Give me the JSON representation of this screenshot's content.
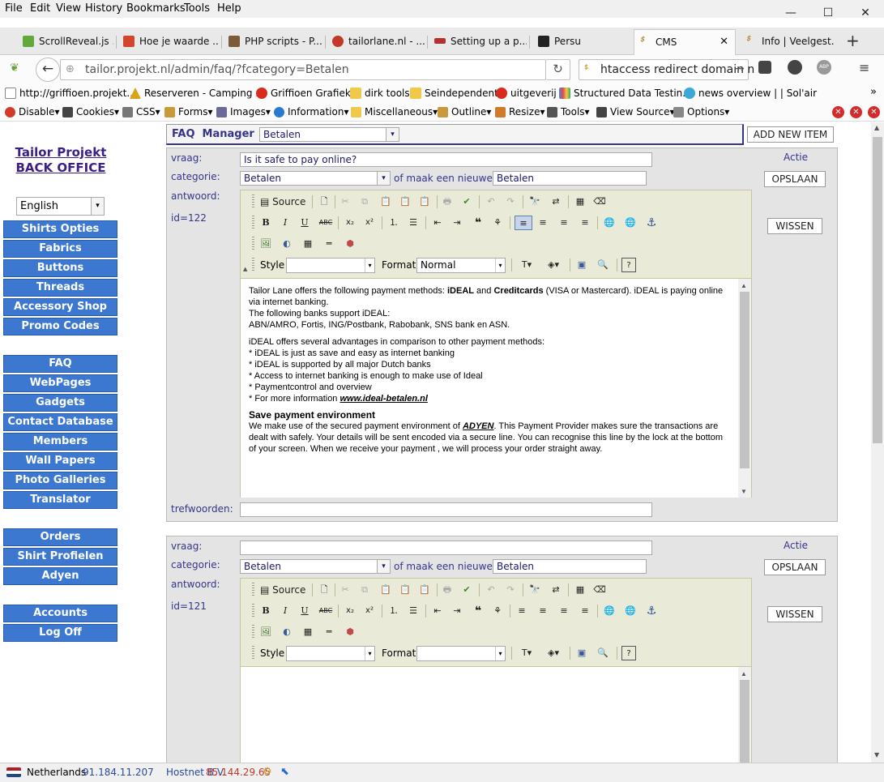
{
  "menubar": {
    "items": [
      "File",
      "Edit",
      "View",
      "History",
      "Bookmarks",
      "Tools",
      "Help"
    ]
  },
  "tabs": [
    {
      "label": "ScrollReveal.js ...",
      "color": "#62a83c"
    },
    {
      "label": "Hoe je waarde ...",
      "color": "#d2452f"
    },
    {
      "label": "PHP scripts - P...",
      "color": "#7b5b3a"
    },
    {
      "label": "tailorlane.nl - ...",
      "color": "#c0392b"
    },
    {
      "label": "Setting up a p...",
      "color": "#b73030"
    },
    {
      "label": "Persu",
      "color": "#222222"
    },
    {
      "label": "CMS",
      "color": "#b5862a"
    },
    {
      "label": "Info | Veelgest...",
      "color": "#b5862a"
    }
  ],
  "nav": {
    "url": "tailor.projekt.nl/admin/faq/?fcategory=Betalen",
    "search": "htaccess redirect domain n"
  },
  "bookmarks": [
    {
      "label": "http://griffioen.projekt....",
      "color": "#ffffff"
    },
    {
      "label": "Reserveren - Camping ...",
      "color": "#d9a21b"
    },
    {
      "label": "Griffioen Grafiek",
      "color": "#d92b1b"
    },
    {
      "label": "dirk tools",
      "color": "#f0c94a"
    },
    {
      "label": "Seindependent",
      "color": "#f0c94a"
    },
    {
      "label": "uitgeverij",
      "color": "#d92b1b"
    },
    {
      "label": "Structured Data Testin...",
      "color": "#4a88e0"
    },
    {
      "label": "news overview | | Sol'air",
      "color": "#3aa9d6"
    }
  ],
  "devbar": [
    {
      "label": "Disable▾",
      "color": "#d43a2a"
    },
    {
      "label": "Cookies▾",
      "color": "#444444"
    },
    {
      "label": "CSS▾",
      "color": "#777777"
    },
    {
      "label": "Forms▾",
      "color": "#c89a3a"
    },
    {
      "label": "Images▾",
      "color": "#6a6a9a"
    },
    {
      "label": "Information▾",
      "color": "#2a7ad0"
    },
    {
      "label": "Miscellaneous▾",
      "color": "#f0c94a"
    },
    {
      "label": "Outline▾",
      "color": "#c89a3a"
    },
    {
      "label": "Resize▾",
      "color": "#d07a2a"
    },
    {
      "label": "Tools▾",
      "color": "#555555"
    },
    {
      "label": "View Source▾",
      "color": "#444444"
    },
    {
      "label": "Options▾",
      "color": "#888888"
    }
  ],
  "sidebar": {
    "logo_line1": "Tailor Projekt",
    "logo_line2": "BACK OFFICE",
    "language": "English",
    "group1": [
      "Shirts Opties",
      "Fabrics",
      "Buttons",
      "Threads",
      "Accessory Shop",
      "Promo Codes"
    ],
    "group2": [
      "FAQ",
      "WebPages",
      "Gadgets",
      "Contact Database",
      "Members",
      "Wall Papers",
      "Photo Galleries",
      "Translator"
    ],
    "group3": [
      "Orders",
      "Shirt Profielen",
      "Adyen Notifications"
    ],
    "group4": [
      "Accounts",
      "Log Off"
    ]
  },
  "header": {
    "title": "FAQ  Manager",
    "category": "Betalen",
    "add_button": "ADD NEW ITEM"
  },
  "labels": {
    "vraag": "vraag:",
    "categorie": "categorie:",
    "antwoord": "antwoord:",
    "trefwoorden": "trefwoorden:",
    "actie": "Actie",
    "nieuwe": "of maak een nieuwe :",
    "save": "OPSLAAN",
    "delete": "WISSEN",
    "source": "Source",
    "style": "Style",
    "format": "Format"
  },
  "items": [
    {
      "question": "Is it safe to pay online?",
      "category": "Betalen",
      "new_category": "Betalen",
      "id_label": "id=122",
      "format_value": "Normal",
      "keywords": "",
      "answer": {
        "p1_pre": "Tailor Lane offers the following payment methods: ",
        "p1_b1": "iDEAL",
        "p1_and": " and ",
        "p1_b2": "Creditcards",
        "p1_post": " (VISA or Mastercard). iDEAL is paying online via internet banking.",
        "p2": "The following banks support iDEAL:",
        "p3": "ABN/AMRO, Fortis, ING/Postbank, Rabobank, SNS bank en ASN.",
        "p4": "iDEAL offers several advantages in comparison to other payment methods:",
        "b1": "* iDEAL is just as save and easy as internet banking",
        "b2": "* iDEAL is supported by all major Dutch banks",
        "b3": "* Access to internet banking is enough to make use of Ideal",
        "b4": "* Paymentcontrol and overview",
        "b5_pre": "* For more information ",
        "b5_link": "www.ideal-betalen.nl",
        "h": "Save payment environment",
        "p5_pre": "We make use of the secured payment environment of ",
        "p5_link": "ADYEN",
        "p5_post": ". This Payment Provider makes sure the transactions are dealt with safely. Your details will be sent encoded via a secure line. You can recognise this line by the lock at the bottom of your screen. When we receive your payment , we will process your order straight away."
      }
    },
    {
      "question": "",
      "category": "Betalen",
      "new_category": "Betalen",
      "id_label": "id=121",
      "format_value": ""
    }
  ],
  "status": {
    "country": "Netherlands",
    "ip1": "91.184.11.207",
    "host": "Hostnet B.V.",
    "ip2": "85.144.29.65"
  },
  "colors": {
    "sidebar_button": "#3c78d0",
    "label": "#36348a",
    "link_red": "#d4261d"
  }
}
